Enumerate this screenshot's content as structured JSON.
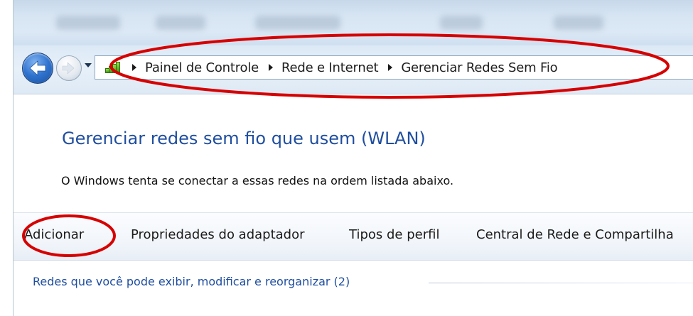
{
  "breadcrumb": {
    "items": [
      "Painel de Controle",
      "Rede e Internet",
      "Gerenciar Redes Sem Fio"
    ]
  },
  "main": {
    "title": "Gerenciar redes sem fio que usem (WLAN)",
    "description": "O Windows tenta se conectar a essas redes na ordem listada abaixo."
  },
  "toolbar": {
    "add_label": "Adicionar",
    "adapter_properties_label": "Propriedades do adaptador",
    "profile_types_label": "Tipos de perfil",
    "network_center_label": "Central de Rede e Compartilha"
  },
  "networks_group": {
    "header": "Redes que você pode exibir, modificar e reorganizar (2)"
  },
  "icons": {
    "back": "back-arrow-icon",
    "forward": "forward-arrow-icon",
    "network": "network-signal-icon",
    "recent_pages": "chevron-down-icon"
  },
  "colors": {
    "accent_title": "#1f4e9f",
    "highlight_ellipse": "#d60000"
  }
}
